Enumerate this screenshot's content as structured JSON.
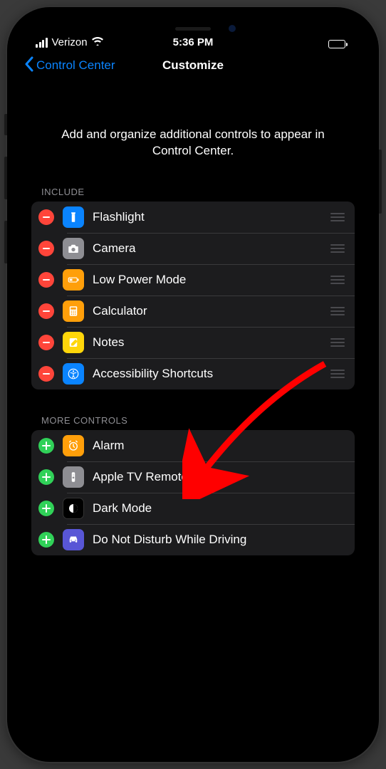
{
  "statusBar": {
    "carrier": "Verizon",
    "time": "5:36 PM"
  },
  "nav": {
    "backLabel": "Control Center",
    "title": "Customize"
  },
  "description": "Add and organize additional controls to appear in Control Center.",
  "sections": {
    "include": {
      "header": "INCLUDE",
      "items": [
        {
          "label": "Flashlight",
          "iconBg": "#0a84ff",
          "iconName": "flashlight-icon"
        },
        {
          "label": "Camera",
          "iconBg": "#8e8e93",
          "iconName": "camera-icon"
        },
        {
          "label": "Low Power Mode",
          "iconBg": "#ff9f0a",
          "iconName": "battery-icon"
        },
        {
          "label": "Calculator",
          "iconBg": "#ff9f0a",
          "iconName": "calculator-icon"
        },
        {
          "label": "Notes",
          "iconBg": "#ffd60a",
          "iconName": "notes-icon"
        },
        {
          "label": "Accessibility Shortcuts",
          "iconBg": "#0a84ff",
          "iconName": "accessibility-icon"
        }
      ]
    },
    "more": {
      "header": "MORE CONTROLS",
      "items": [
        {
          "label": "Alarm",
          "iconBg": "#ff9f0a",
          "iconName": "alarm-icon"
        },
        {
          "label": "Apple TV Remote",
          "iconBg": "#8e8e93",
          "iconName": "remote-icon"
        },
        {
          "label": "Dark Mode",
          "iconBg": "#000000",
          "iconName": "darkmode-icon"
        },
        {
          "label": "Do Not Disturb While Driving",
          "iconBg": "#5856d6",
          "iconName": "car-icon"
        }
      ]
    }
  }
}
